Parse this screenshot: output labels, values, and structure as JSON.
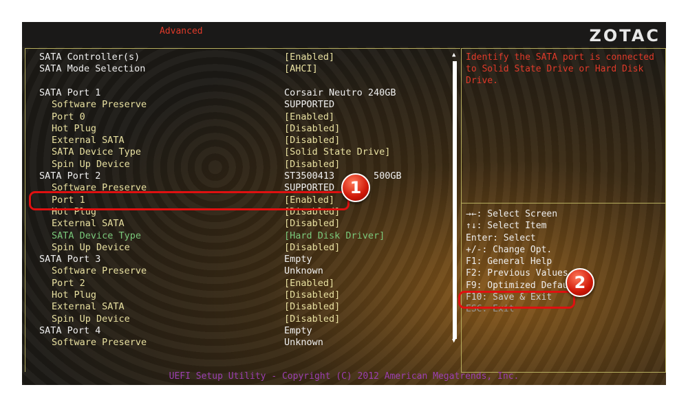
{
  "header": {
    "tab": "Advanced",
    "logo": "ZOTAC"
  },
  "colors": {
    "accent": "#e03a2a",
    "label": "#e8e0a0",
    "white": "#f0f0f0",
    "green": "#7ac87a",
    "footer": "#9b3fb0",
    "highlight": "#e01010"
  },
  "settings": [
    {
      "label": "SATA Controller(s)",
      "value": "[Enabled]",
      "indent": 0
    },
    {
      "label": "SATA Mode Selection",
      "value": "[AHCI]",
      "indent": 0
    },
    {
      "label": "",
      "value": "",
      "indent": 0
    },
    {
      "label": "SATA Port 1",
      "value": "Corsair Neutro 240GB",
      "indent": 0
    },
    {
      "label": "Software Preserve",
      "value": "SUPPORTED",
      "indent": 1
    },
    {
      "label": "Port 0",
      "value": "[Enabled]",
      "indent": 1
    },
    {
      "label": "Hot Plug",
      "value": "[Disabled]",
      "indent": 1
    },
    {
      "label": "External SATA",
      "value": "[Disabled]",
      "indent": 1
    },
    {
      "label": "SATA Device Type",
      "value": "[Solid State Drive]",
      "indent": 1
    },
    {
      "label": "Spin Up Device",
      "value": "[Disabled]",
      "indent": 1
    },
    {
      "label": "SATA Port 2",
      "value": "ST3500413       500GB",
      "indent": 0
    },
    {
      "label": "Software Preserve",
      "value": "SUPPORTED",
      "indent": 1
    },
    {
      "label": "Port 1",
      "value": "[Enabled]",
      "indent": 1
    },
    {
      "label": "Hot Plug",
      "value": "[Disabled]",
      "indent": 1
    },
    {
      "label": "External SATA",
      "value": "[Disabled]",
      "indent": 1
    },
    {
      "label": "SATA Device Type",
      "value": "[Hard Disk Driver]",
      "indent": 1,
      "selected": true
    },
    {
      "label": "Spin Up Device",
      "value": "[Disabled]",
      "indent": 1
    },
    {
      "label": "SATA Port 3",
      "value": "Empty",
      "indent": 0
    },
    {
      "label": "Software Preserve",
      "value": "Unknown",
      "indent": 1
    },
    {
      "label": "Port 2",
      "value": "[Enabled]",
      "indent": 1
    },
    {
      "label": "Hot Plug",
      "value": "[Disabled]",
      "indent": 1
    },
    {
      "label": "External SATA",
      "value": "[Disabled]",
      "indent": 1
    },
    {
      "label": "Spin Up Device",
      "value": "[Disabled]",
      "indent": 1
    },
    {
      "label": "SATA Port 4",
      "value": "Empty",
      "indent": 0
    },
    {
      "label": "Software Preserve",
      "value": "Unknown",
      "indent": 1
    }
  ],
  "help_text": "Identify the SATA port is connected to Solid State Drive or Hard Disk Drive.",
  "keys": [
    "→←: Select Screen",
    "↑↓: Select Item",
    "Enter: Select",
    "+/-: Change Opt.",
    "F1: General Help",
    "F2: Previous Values",
    "F9: Optimized Defaults",
    "F10: Save & Exit",
    "ESC: Exit"
  ],
  "footer": "UEFI Setup Utility - Copyright (C) 2012 American Megatrends, Inc.",
  "annotations": {
    "badge1": "1",
    "badge2": "2"
  }
}
